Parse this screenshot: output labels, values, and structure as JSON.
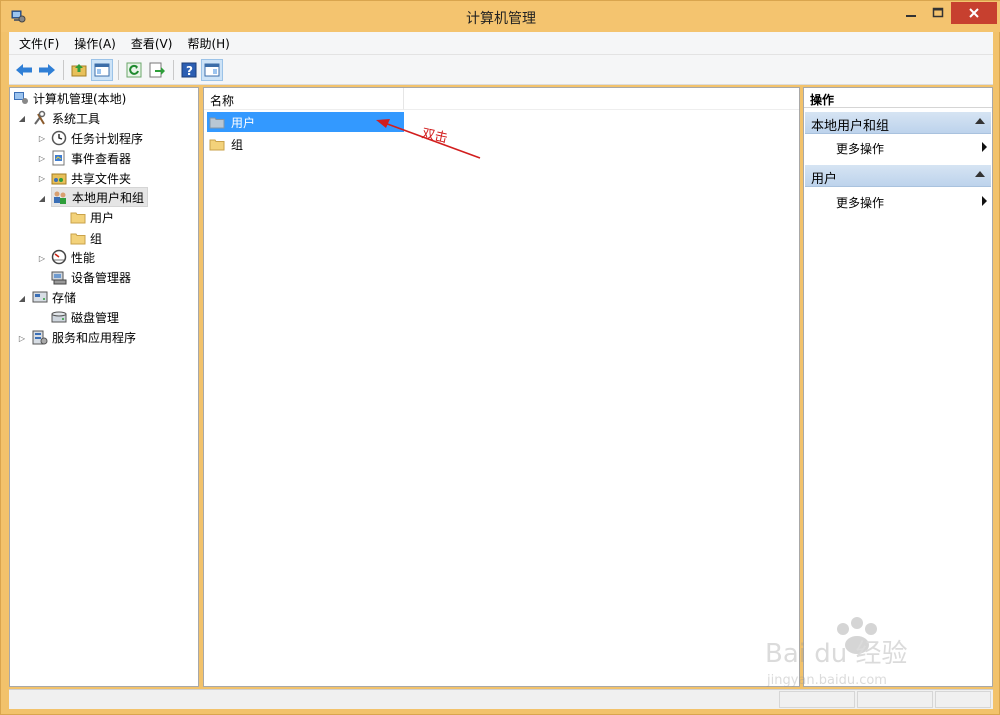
{
  "window": {
    "title": "计算机管理"
  },
  "menu": [
    "文件(F)",
    "操作(A)",
    "查看(V)",
    "帮助(H)"
  ],
  "tree": {
    "root": "计算机管理(本地)",
    "system_tools": "系统工具",
    "task_scheduler": "任务计划程序",
    "event_viewer": "事件查看器",
    "shared_folders": "共享文件夹",
    "local_users_groups": "本地用户和组",
    "users": "用户",
    "groups": "组",
    "performance": "性能",
    "device_manager": "设备管理器",
    "storage": "存储",
    "disk_management": "磁盘管理",
    "services_apps": "服务和应用程序"
  },
  "list": {
    "column_name": "名称",
    "rows": [
      "用户",
      "组"
    ]
  },
  "annotation": {
    "text": "双击",
    "color": "#d21e1e"
  },
  "actions": {
    "header": "操作",
    "group1": "本地用户和组",
    "group1_more": "更多操作",
    "group2": "用户",
    "group2_more": "更多操作"
  },
  "watermark": {
    "brand": "Bai du 经验",
    "url": "jingyan.baidu.com"
  },
  "colors": {
    "title_bar": "#f4c46f",
    "selection": "#3399ff",
    "close_button": "#c7402f"
  }
}
